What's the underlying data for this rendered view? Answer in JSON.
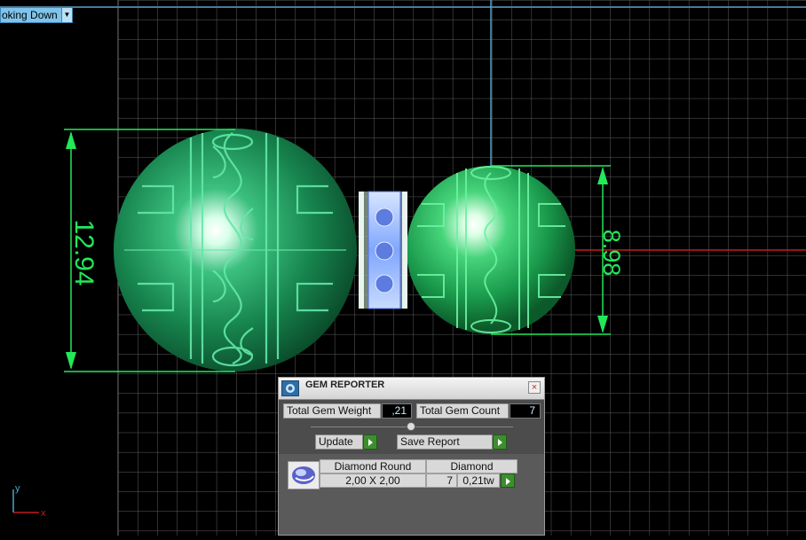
{
  "viewport": {
    "label": "oking Down",
    "dimensions": {
      "left_sphere": "12.94",
      "right_sphere": "8.98"
    },
    "axes": {
      "y": "y",
      "x": "x"
    }
  },
  "gem_reporter": {
    "title": "GEM REPORTER",
    "close_glyph": "×",
    "total_weight_label": "Total Gem Weight",
    "total_weight_value": ",21",
    "total_count_label": "Total Gem Count",
    "total_count_value": "7",
    "update_label": "Update",
    "save_report_label": "Save Report",
    "rows": [
      {
        "name": "Diamond Round",
        "material": "Diamond",
        "size": "2,00 X 2,00",
        "count": "7",
        "weight": "0,21tw"
      }
    ]
  },
  "colors": {
    "dimension": "#23e85a",
    "grid": "#5f5f5f",
    "axis_x": "#c41c1c",
    "axis_y": "#4fa3c4",
    "gem_green": "#1f9a62",
    "diamond_blue": "#8eb8ff"
  }
}
